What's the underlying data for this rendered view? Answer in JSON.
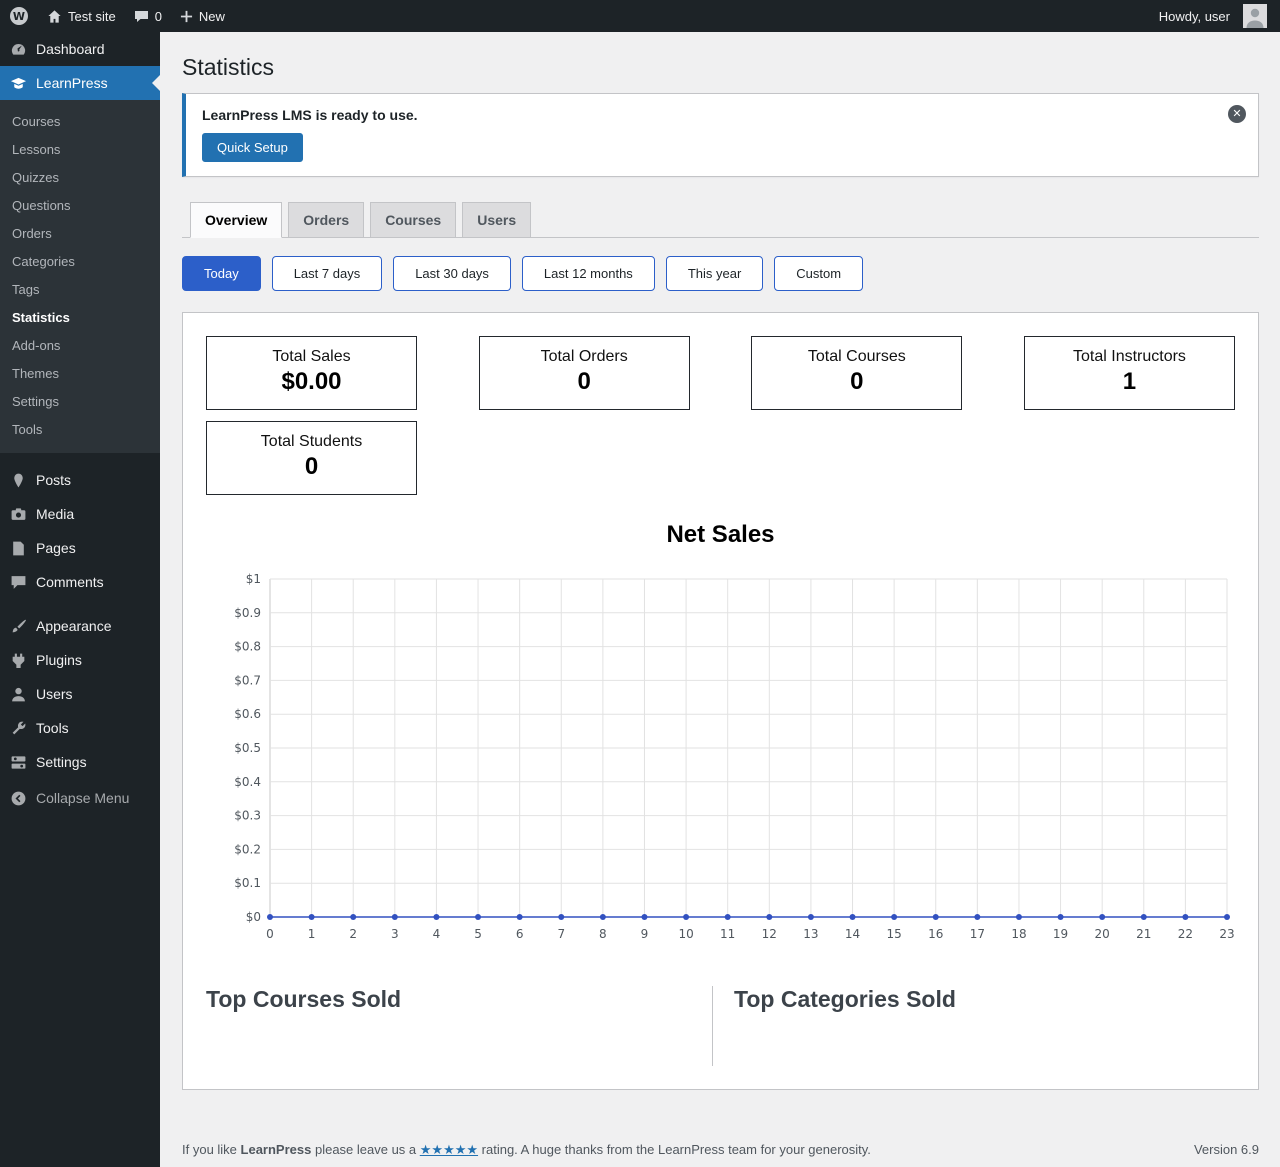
{
  "colors": {
    "adminbar_bg": "#1d2327",
    "sidebar_bg": "#1d2327",
    "submenu_bg": "#2c3338",
    "active_menu_blue": "#2271b1",
    "filter_blue": "#2c5fc9",
    "page_bg": "#f0f0f1",
    "chart_line": "#3251c0"
  },
  "icons": {
    "wordpress-logo-icon": "W in circle",
    "home-icon": "house",
    "comments-bubble-icon": "speech bubble",
    "plus-icon": "+",
    "avatar": "user silhouette",
    "dashboard-icon": "gauge",
    "learnpress-icon": "graduation cap",
    "posts-icon": "pin",
    "media-icon": "camera",
    "pages-icon": "page",
    "comments-icon": "speech bubble",
    "appearance-icon": "paintbrush",
    "plugins-icon": "plug",
    "users-icon": "person",
    "tools-icon": "wrench",
    "settings-icon": "sliders",
    "collapse-icon": "circled left chevron",
    "dismiss-icon": "circled x"
  },
  "admin_bar": {
    "site_name": "Test site",
    "comments_count": "0",
    "new_label": "New",
    "howdy_text": "Howdy, user"
  },
  "sidebar": {
    "dashboard_label": "Dashboard",
    "learnpress_label": "LearnPress",
    "learnpress_submenu": [
      {
        "label": "Courses"
      },
      {
        "label": "Lessons"
      },
      {
        "label": "Quizzes"
      },
      {
        "label": "Questions"
      },
      {
        "label": "Orders"
      },
      {
        "label": "Categories"
      },
      {
        "label": "Tags"
      },
      {
        "label": "Statistics",
        "current": true
      },
      {
        "label": "Add-ons"
      },
      {
        "label": "Themes"
      },
      {
        "label": "Settings"
      },
      {
        "label": "Tools"
      }
    ],
    "items_content": [
      {
        "label": "Posts"
      },
      {
        "label": "Media"
      },
      {
        "label": "Pages"
      },
      {
        "label": "Comments"
      }
    ],
    "items_admin": [
      {
        "label": "Appearance"
      },
      {
        "label": "Plugins"
      },
      {
        "label": "Users"
      },
      {
        "label": "Tools"
      },
      {
        "label": "Settings"
      }
    ],
    "collapse_label": "Collapse Menu"
  },
  "page": {
    "title": "Statistics",
    "notice": {
      "message": "LearnPress LMS is ready to use.",
      "button_label": "Quick Setup"
    },
    "tabs": [
      {
        "label": "Overview",
        "active": true
      },
      {
        "label": "Orders",
        "active": false
      },
      {
        "label": "Courses",
        "active": false
      },
      {
        "label": "Users",
        "active": false
      }
    ],
    "filters": [
      {
        "label": "Today",
        "active": true
      },
      {
        "label": "Last 7 days",
        "active": false
      },
      {
        "label": "Last 30 days",
        "active": false
      },
      {
        "label": "Last 12 months",
        "active": false
      },
      {
        "label": "This year",
        "active": false
      },
      {
        "label": "Custom",
        "active": false
      }
    ],
    "stats": [
      {
        "label": "Total Sales",
        "value": "$0.00"
      },
      {
        "label": "Total Orders",
        "value": "0"
      },
      {
        "label": "Total Courses",
        "value": "0"
      },
      {
        "label": "Total Instructors",
        "value": "1"
      },
      {
        "label": "Total Students",
        "value": "0"
      }
    ],
    "sections": {
      "top_courses_title": "Top Courses Sold",
      "top_categories_title": "Top Categories Sold"
    }
  },
  "chart_data": {
    "type": "line",
    "title": "Net Sales",
    "x": [
      0,
      1,
      2,
      3,
      4,
      5,
      6,
      7,
      8,
      9,
      10,
      11,
      12,
      13,
      14,
      15,
      16,
      17,
      18,
      19,
      20,
      21,
      22,
      23
    ],
    "series": [
      {
        "name": "Net Sales",
        "values": [
          0,
          0,
          0,
          0,
          0,
          0,
          0,
          0,
          0,
          0,
          0,
          0,
          0,
          0,
          0,
          0,
          0,
          0,
          0,
          0,
          0,
          0,
          0,
          0
        ]
      }
    ],
    "xlabel": "",
    "ylabel": "",
    "ylim": [
      0,
      1
    ],
    "ytick_labels": [
      "$0",
      "$0.1",
      "$0.2",
      "$0.3",
      "$0.4",
      "$0.5",
      "$0.6",
      "$0.7",
      "$0.8",
      "$0.9",
      "$1"
    ],
    "grid": true,
    "legend": false,
    "line_color": "#3251c0"
  },
  "footer": {
    "text_prefix": "If you like ",
    "brand": "LearnPress",
    "text_mid": " please leave us a ",
    "stars": "★★★★★",
    "text_suffix": " rating. A huge thanks from the LearnPress team for your generosity.",
    "version": "Version 6.9"
  }
}
